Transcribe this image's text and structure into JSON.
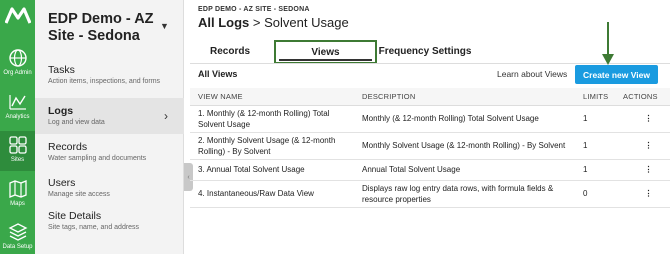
{
  "rail": {
    "items": [
      {
        "label": "Org Admin",
        "icon": "globe-icon"
      },
      {
        "label": "Analytics",
        "icon": "line-chart-icon"
      },
      {
        "label": "Sites",
        "icon": "grid-icon"
      },
      {
        "label": "Maps",
        "icon": "map-icon"
      },
      {
        "label": "Data Setup",
        "icon": "layers-icon"
      }
    ],
    "active": "Sites",
    "color": "#3aa84a"
  },
  "site": {
    "name": "EDP Demo - AZ Site - Sedona"
  },
  "nav": {
    "items": [
      {
        "title": "Tasks",
        "subtitle": "Action items, inspections, and forms"
      },
      {
        "title": "Logs",
        "subtitle": "Log and view data"
      },
      {
        "title": "Records",
        "subtitle": "Water sampling and documents"
      },
      {
        "title": "Users",
        "subtitle": "Manage site access"
      },
      {
        "title": "Site Details",
        "subtitle": "Site tags, name, and address"
      }
    ],
    "active": "Logs"
  },
  "header": {
    "breadcrumb": "EDP DEMO - AZ SITE - SEDONA",
    "title_main": "All Logs",
    "separator": ">",
    "title_sub": "Solvent Usage"
  },
  "tabs": [
    {
      "label": "Records"
    },
    {
      "label": "Views"
    },
    {
      "label": "Frequency Settings"
    }
  ],
  "active_tab": "Views",
  "section": {
    "title": "All Views",
    "learn_link": "Learn about Views",
    "create_button": "Create new View",
    "accent_color": "#1a9be0"
  },
  "table": {
    "columns": [
      "VIEW NAME",
      "DESCRIPTION",
      "LIMITS",
      "ACTIONS"
    ],
    "rows": [
      {
        "name": "1. Monthly (& 12-month Rolling) Total Solvent Usage",
        "description": "Monthly (& 12-month Rolling) Total Solvent Usage",
        "limits": "1"
      },
      {
        "name": "2. Monthly Solvent Usage (& 12-month Rolling) - By Solvent",
        "description": "Monthly Solvent Usage (& 12-month Rolling) - By Solvent",
        "limits": "1"
      },
      {
        "name": "3. Annual Total Solvent Usage",
        "description": "Annual Total Solvent Usage",
        "limits": "1"
      },
      {
        "name": "4. Instantaneous/Raw Data View",
        "description": "Displays raw log entry data rows, with formula fields & resource properties",
        "limits": "0"
      }
    ]
  }
}
